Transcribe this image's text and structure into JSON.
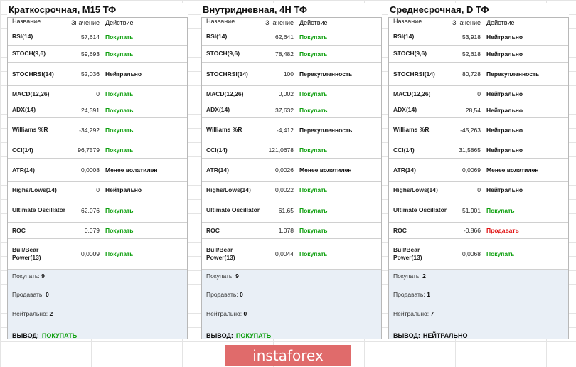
{
  "headers": {
    "name": "Название",
    "value": "Значение",
    "action": "Действие"
  },
  "panels": [
    {
      "title": "Краткосрочная, M15 ТФ",
      "rows": [
        {
          "name": "RSI(14)",
          "value": "57,614",
          "action": "Покупать",
          "status": "buy"
        },
        {
          "name": "STOCH(9,6)",
          "value": "59,693",
          "action": "Покупать",
          "status": "buy"
        },
        {
          "name": "STOCHRSI(14)",
          "value": "52,036",
          "action": "Нейтрально",
          "status": "neutral"
        },
        {
          "name": "MACD(12,26)",
          "value": "0",
          "action": "Покупать",
          "status": "buy"
        },
        {
          "name": "ADX(14)",
          "value": "24,391",
          "action": "Покупать",
          "status": "buy"
        },
        {
          "name": "Williams %R",
          "value": "-34,292",
          "action": "Покупать",
          "status": "buy"
        },
        {
          "name": "CCI(14)",
          "value": "96,7579",
          "action": "Покупать",
          "status": "buy"
        },
        {
          "name": "ATR(14)",
          "value": "0,0008",
          "action": "Менее волатилен",
          "status": "neutral"
        },
        {
          "name": "Highs/Lows(14)",
          "value": "0",
          "action": "Нейтрально",
          "status": "neutral"
        },
        {
          "name": "Ultimate Oscillator",
          "value": "62,076",
          "action": "Покупать",
          "status": "buy"
        },
        {
          "name": "ROC",
          "value": "0,079",
          "action": "Покупать",
          "status": "buy"
        },
        {
          "name": "Bull/Bear Power(13)",
          "value": "0,0009",
          "action": "Покупать",
          "status": "buy"
        }
      ],
      "summary": {
        "buy_label": "Покупать:",
        "buy": "9",
        "sell_label": "Продавать:",
        "sell": "0",
        "neutral_label": "Нейтрально:",
        "neutral": "2",
        "verdict_label": "ВЫВОД:",
        "verdict": "ПОКУПАТЬ",
        "verdict_status": "buy"
      }
    },
    {
      "title": "Внутридневная, 4H ТФ",
      "rows": [
        {
          "name": "RSI(14)",
          "value": "62,641",
          "action": "Покупать",
          "status": "buy"
        },
        {
          "name": "STOCH(9,6)",
          "value": "78,482",
          "action": "Покупать",
          "status": "buy"
        },
        {
          "name": "STOCHRSI(14)",
          "value": "100",
          "action": "Перекупленность",
          "status": "neutral"
        },
        {
          "name": "MACD(12,26)",
          "value": "0,002",
          "action": "Покупать",
          "status": "buy"
        },
        {
          "name": "ADX(14)",
          "value": "37,632",
          "action": "Покупать",
          "status": "buy"
        },
        {
          "name": "Williams %R",
          "value": "-4,412",
          "action": "Перекупленность",
          "status": "neutral"
        },
        {
          "name": "CCI(14)",
          "value": "121,0678",
          "action": "Покупать",
          "status": "buy"
        },
        {
          "name": "ATR(14)",
          "value": "0,0026",
          "action": "Менее волатилен",
          "status": "neutral"
        },
        {
          "name": "Highs/Lows(14)",
          "value": "0,0022",
          "action": "Покупать",
          "status": "buy"
        },
        {
          "name": "Ultimate Oscillator",
          "value": "61,65",
          "action": "Покупать",
          "status": "buy"
        },
        {
          "name": "ROC",
          "value": "1,078",
          "action": "Покупать",
          "status": "buy"
        },
        {
          "name": "Bull/Bear Power(13)",
          "value": "0,0044",
          "action": "Покупать",
          "status": "buy"
        }
      ],
      "summary": {
        "buy_label": "Покупать:",
        "buy": "9",
        "sell_label": "Продавать:",
        "sell": "0",
        "neutral_label": "Нейтрально:",
        "neutral": "0",
        "verdict_label": "ВЫВОД:",
        "verdict": "ПОКУПАТЬ",
        "verdict_status": "buy"
      }
    },
    {
      "title": "Среднесрочная, D ТФ",
      "rows": [
        {
          "name": "RSI(14)",
          "value": "53,918",
          "action": "Нейтрально",
          "status": "neutral"
        },
        {
          "name": "STOCH(9,6)",
          "value": "52,618",
          "action": "Нейтрально",
          "status": "neutral"
        },
        {
          "name": "STOCHRSI(14)",
          "value": "80,728",
          "action": "Перекупленность",
          "status": "neutral"
        },
        {
          "name": "MACD(12,26)",
          "value": "0",
          "action": "Нейтрально",
          "status": "neutral"
        },
        {
          "name": "ADX(14)",
          "value": "28,54",
          "action": "Нейтрально",
          "status": "neutral"
        },
        {
          "name": "Williams %R",
          "value": "-45,263",
          "action": "Нейтрально",
          "status": "neutral"
        },
        {
          "name": "CCI(14)",
          "value": "31,5865",
          "action": "Нейтрально",
          "status": "neutral"
        },
        {
          "name": "ATR(14)",
          "value": "0,0069",
          "action": "Менее волатилен",
          "status": "neutral"
        },
        {
          "name": "Highs/Lows(14)",
          "value": "0",
          "action": "Нейтрально",
          "status": "neutral"
        },
        {
          "name": "Ultimate Oscillator",
          "value": "51,901",
          "action": "Покупать",
          "status": "buy"
        },
        {
          "name": "ROC",
          "value": "-0,866",
          "action": "Продавать",
          "status": "sell"
        },
        {
          "name": "Bull/Bear Power(13)",
          "value": "0,0068",
          "action": "Покупать",
          "status": "buy"
        }
      ],
      "summary": {
        "buy_label": "Покупать:",
        "buy": "2",
        "sell_label": "Продавать:",
        "sell": "1",
        "neutral_label": "Нейтрально:",
        "neutral": "7",
        "verdict_label": "ВЫВОД:",
        "verdict": "НЕЙТРАЛЬНО",
        "verdict_status": "neutral"
      }
    }
  ],
  "logo": {
    "text": "instaforex"
  }
}
